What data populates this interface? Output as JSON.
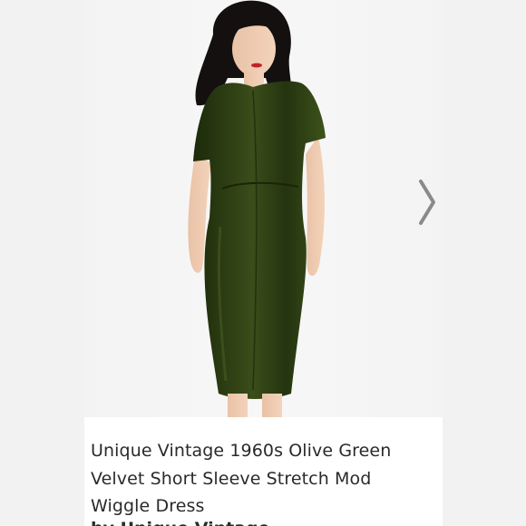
{
  "product": {
    "title": "Unique Vintage 1960s Olive Green Velvet Short Sleeve Stretch Mod Wiggle Dress",
    "brand_partial": "by Unique Vintage",
    "image_icon": "dress-photo",
    "next_icon": "chevron-right-icon"
  },
  "colors": {
    "dress": "#2a3a12",
    "background": "#f4f4f4",
    "caption_bg": "#ffffff",
    "text": "#2a2a2a",
    "arrow": "#8a8a8a"
  }
}
